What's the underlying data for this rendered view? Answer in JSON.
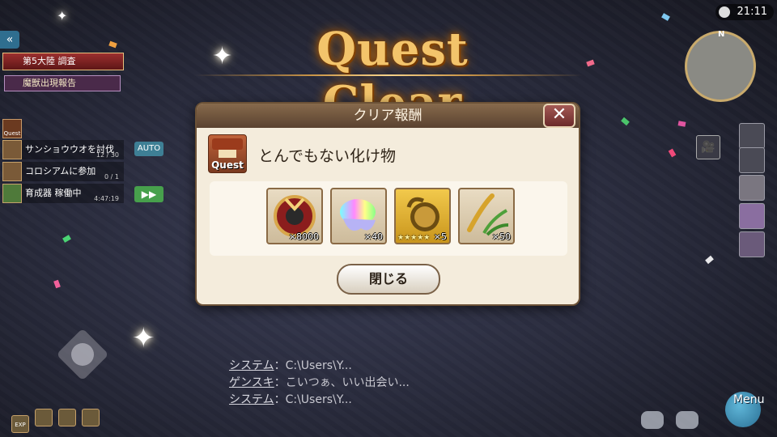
{
  "title": "Quest Clear",
  "dialog": {
    "header": "クリア報酬",
    "quest_icon_label": "Quest",
    "quest_name": "とんでもない化け物",
    "rewards": [
      {
        "icon": "shield-item-icon",
        "qty": "×8000"
      },
      {
        "icon": "rainbow-slime-icon",
        "qty": "×40"
      },
      {
        "icon": "golden-pot-icon",
        "stars": "★★★★★",
        "qty": "×5"
      },
      {
        "icon": "rice-plant-icon",
        "qty": "×50"
      }
    ],
    "close_button": "閉じる"
  },
  "hud_left": {
    "back": "«",
    "banner": "第5大陸 調査",
    "notice": "魔獣出現報告",
    "quest_list_label": "Quest",
    "tasks": [
      {
        "label": "サンショウウオを討伐",
        "progress": "12 / 30"
      },
      {
        "label": "コロシアムに参加",
        "progress": "0 / 1"
      },
      {
        "label": "育成器 稼働中",
        "progress": "4:47:19"
      }
    ],
    "auto": "AUTO",
    "fast_forward": "▶▶",
    "bottom_icons": [
      "EXP",
      "",
      "",
      ""
    ]
  },
  "chat": [
    {
      "name": "システム",
      "text": "：C:\\Users\\Y..."
    },
    {
      "name": "ゲンスキ",
      "text": "：こいつぁ、いい出会い..."
    },
    {
      "name": "システム",
      "text": "：C:\\Users\\Y..."
    }
  ],
  "hud_right": {
    "clock": "21:11",
    "compass_north": "N",
    "camera": "🎥",
    "menu": "Menu"
  }
}
